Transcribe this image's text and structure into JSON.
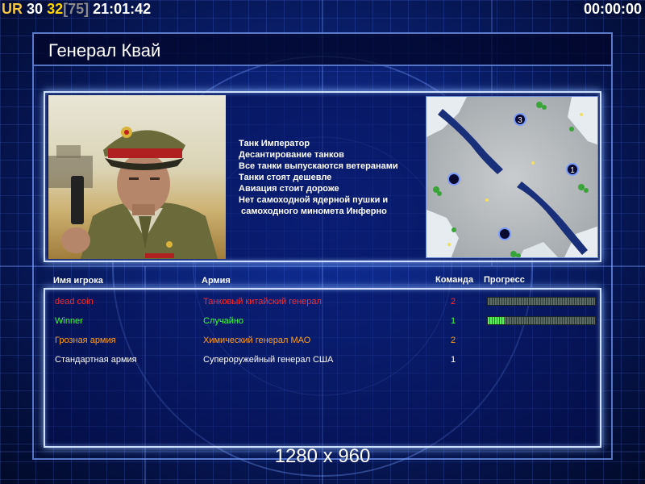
{
  "hud": {
    "prefix": "UR",
    "value_a": "30",
    "value_b": "32",
    "bracket": "[75]",
    "clock": "21:01:42",
    "timer": "00:00:00"
  },
  "title": "Генерал Квай",
  "features": [
    "Танк Император",
    "Десантирование танков",
    "Все танки выпускаются ветеранами",
    "Танки стоят дешевле",
    "Авиация стоит дороже",
    "Нет самоходной ядерной пушки и",
    " самоходного миномета Инферно"
  ],
  "minimap": {
    "start_markers": [
      "3",
      "1"
    ]
  },
  "table": {
    "headers": {
      "name": "Имя игрока",
      "army": "Армия",
      "team": "Команда",
      "progress": "Прогресс"
    },
    "rows": [
      {
        "name": "dead coin",
        "army": "Танковый китайский генерал",
        "team": "2",
        "color": "#ff2a2a",
        "progress": 0
      },
      {
        "name": "Winner",
        "army": "Случайно",
        "team": "1",
        "color": "#3cff3c",
        "progress": 0.16
      },
      {
        "name": "Грозная армия",
        "army": "Химический генерал МАО",
        "team": "2",
        "color": "#ffa020",
        "progress": null
      },
      {
        "name": "Стандартная армия",
        "army": "Супероружейный генерал США",
        "team": "1",
        "color": "#ffffff",
        "progress": null
      }
    ]
  },
  "resolution": "1280 x 960"
}
